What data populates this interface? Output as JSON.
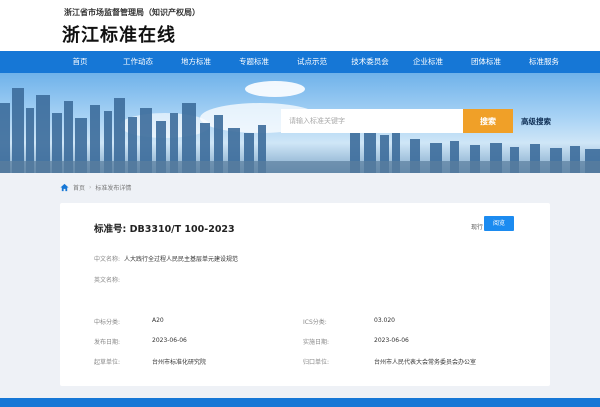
{
  "header": {
    "org_name": "浙江省市场监督管理局（知识产权局）",
    "site_title": "浙江标准在线"
  },
  "nav": {
    "items": [
      {
        "label": "首页"
      },
      {
        "label": "工作动态"
      },
      {
        "label": "地方标准"
      },
      {
        "label": "专题标准"
      },
      {
        "label": "试点示范"
      },
      {
        "label": "技术委员会"
      },
      {
        "label": "企业标准"
      },
      {
        "label": "团体标准"
      },
      {
        "label": "标准服务"
      }
    ]
  },
  "search": {
    "placeholder": "请输入标准关键字",
    "button_label": "搜索",
    "advanced_label": "高级搜索"
  },
  "breadcrumb": {
    "home": "首页",
    "sep": "›",
    "current": "标准发布详情"
  },
  "detail": {
    "std_no": "标准号:  DB3310/T 100-2023",
    "status": "现行",
    "view_label": "阅览",
    "cn_name_label": "中文名称:",
    "cn_name": "人大践行全过程人民民主基层单元建设规范",
    "en_name_label": "英文名称:",
    "en_name": "",
    "fields": [
      {
        "label": "中标分类:",
        "value": "A20",
        "label2": "ICS分类:",
        "value2": "03.020"
      },
      {
        "label": "发布日期:",
        "value": "2023-06-06",
        "label2": "实施日期:",
        "value2": "2023-06-06"
      },
      {
        "label": "起草单位:",
        "value": "台州市标准化研究院",
        "label2": "归口单位:",
        "value2": "台州市人民代表大会常务委员会办公室"
      }
    ]
  },
  "colors": {
    "nav_blue": "#1677d6",
    "search_orange": "#f0a028",
    "view_blue": "#1c8bf0"
  }
}
